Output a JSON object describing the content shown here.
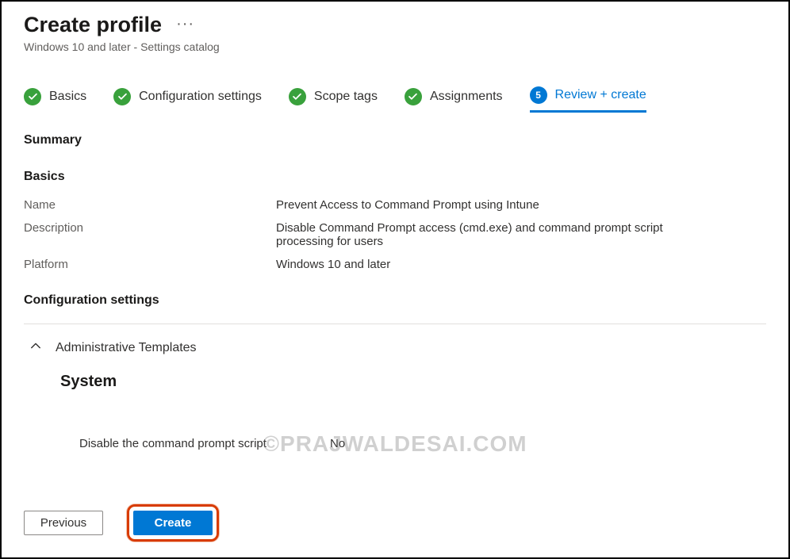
{
  "header": {
    "title": "Create profile",
    "subtitle": "Windows 10 and later - Settings catalog"
  },
  "steps": [
    {
      "label": "Basics",
      "state": "done"
    },
    {
      "label": "Configuration settings",
      "state": "done"
    },
    {
      "label": "Scope tags",
      "state": "done"
    },
    {
      "label": "Assignments",
      "state": "done"
    },
    {
      "label": "Review + create",
      "state": "active",
      "number": "5"
    }
  ],
  "summary": {
    "heading": "Summary",
    "basics_heading": "Basics",
    "name_label": "Name",
    "name_value": "Prevent Access to Command Prompt using Intune",
    "description_label": "Description",
    "description_value": "Disable Command Prompt access (cmd.exe) and command prompt script processing for users",
    "platform_label": "Platform",
    "platform_value": "Windows 10 and later"
  },
  "config_section": {
    "heading": "Configuration settings",
    "group_label": "Administrative Templates",
    "subgroup_label": "System",
    "setting_name": "Disable the command prompt script",
    "setting_value": "No"
  },
  "footer": {
    "previous": "Previous",
    "create": "Create"
  },
  "watermark": "©PRAJWALDESAI.COM"
}
